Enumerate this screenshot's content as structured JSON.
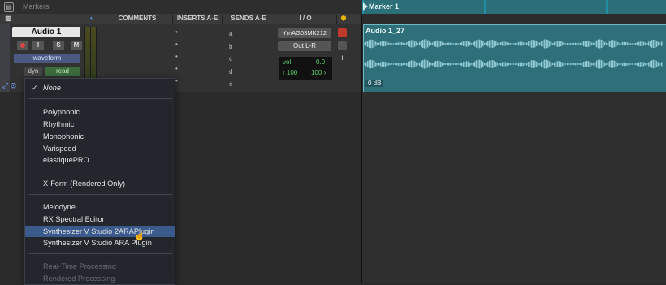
{
  "rulers": {
    "markers_label": "Markers",
    "marker_1": "Marker 1"
  },
  "columns": {
    "comments": "COMMENTS",
    "inserts": "INSERTS A-E",
    "sends": "SENDS A-E",
    "io": "I / O"
  },
  "track": {
    "name": "Audio 1",
    "input_btn": "I",
    "solo_btn": "S",
    "mute_btn": "M",
    "view": "waveform",
    "dyn": "dyn",
    "automation": "read",
    "sends": [
      "a",
      "b",
      "c",
      "d",
      "e"
    ],
    "io_input": "YmAG03MK212",
    "io_output": "Out L-R",
    "vol_label": "vol",
    "vol_value": "0.0",
    "pan_left": "‹ 100",
    "pan_right": "100 ›"
  },
  "clip": {
    "name": "Audio 1_27",
    "gain": "0 dB"
  },
  "menu": {
    "none": "None",
    "group1": [
      "Polyphonic",
      "Rhythmic",
      "Monophonic",
      "Varispeed",
      "elastiquePRO"
    ],
    "xform": "X-Form (Rendered Only)",
    "group3": [
      "Melodyne",
      "RX Spectral Editor",
      "Synthesizer V Studio 2ARAPlugin",
      "Synthesizer V Studio ARA Plugin"
    ],
    "highlighted_index": 2,
    "disabled": [
      "Real-Time Processing",
      "Rendered Processing"
    ]
  },
  "colors": {
    "clip": "#2e6f7a",
    "menu_highlight": "#3a5a8c",
    "record": "#c0392b"
  }
}
